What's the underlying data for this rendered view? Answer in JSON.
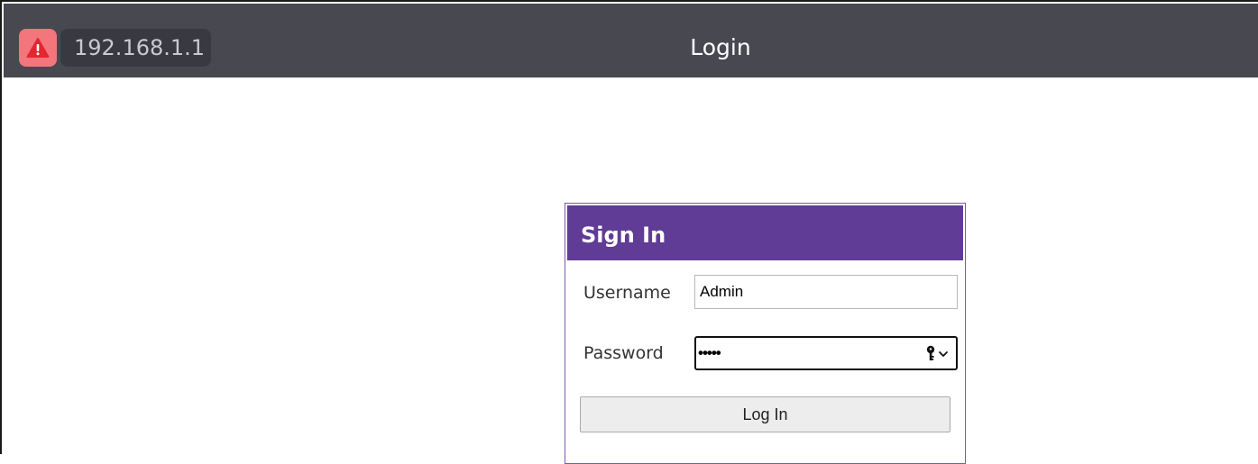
{
  "window": {
    "address": "192.168.1.1",
    "title": "Login",
    "security_icon": "warning-triangle-icon",
    "colors": {
      "titlebar": "#484851",
      "address_background": "#393941",
      "warning": "#f2767b"
    }
  },
  "signin": {
    "heading": "Sign In",
    "header_color": "#603c97",
    "username_label": "Username",
    "username_value": "Admin",
    "password_label": "Password",
    "password_masked": "•••••",
    "password_tool_icon": "key-icon",
    "login_button_label": "Log In"
  }
}
